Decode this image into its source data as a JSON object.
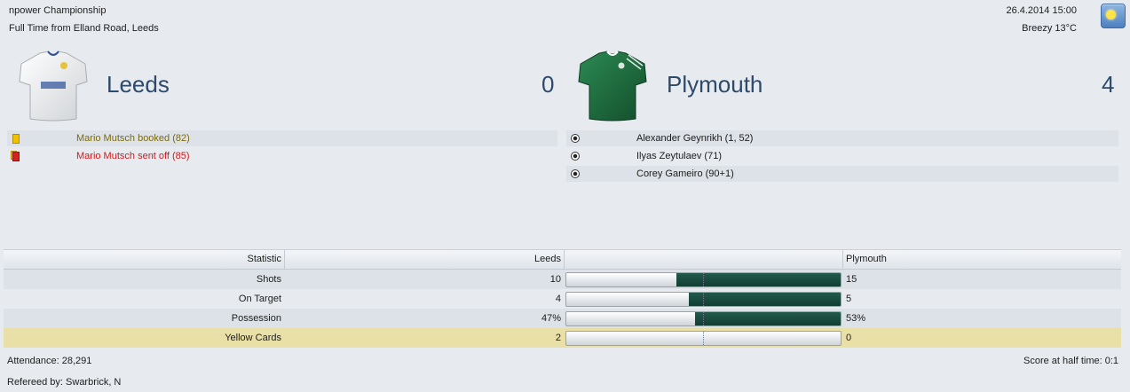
{
  "match": {
    "competition": "npower Championship",
    "result_line": "Full Time from Elland Road, Leeds",
    "datetime": "26.4.2014 15:00",
    "weather": "Breezy 13°C",
    "weather_icon": "sun-icon"
  },
  "home": {
    "name": "Leeds",
    "score": "0",
    "shirt_color": "#f4f4f4",
    "events": [
      {
        "type": "yellow-card",
        "text": "Mario Mutsch booked (82)"
      },
      {
        "type": "red-card",
        "text": "Mario Mutsch sent off (85)"
      }
    ]
  },
  "away": {
    "name": "Plymouth",
    "score": "4",
    "shirt_color": "#1f6b3f",
    "events": [
      {
        "type": "goal",
        "text": "Alexander Geynrikh (1, 52)"
      },
      {
        "type": "goal",
        "text": "Ilyas Zeytulaev (71)"
      },
      {
        "type": "goal",
        "text": "Corey Gameiro (90+1)"
      }
    ]
  },
  "stats": {
    "header": {
      "statistic": "Statistic",
      "home": "Leeds",
      "away": "Plymouth"
    },
    "rows": [
      {
        "label": "Shots",
        "home": "10",
        "away": "15",
        "away_share": 0.6
      },
      {
        "label": "On Target",
        "home": "4",
        "away": "5",
        "away_share": 0.555
      },
      {
        "label": "Possession",
        "home": "47%",
        "away": "53%",
        "away_share": 0.53
      },
      {
        "label": "Yellow Cards",
        "home": "2",
        "away": "0",
        "away_share": 0.0
      }
    ]
  },
  "footer": {
    "attendance": "Attendance: 28,291",
    "referee": "Refereed by: Swarbrick, N",
    "half_time": "Score at half time: 0:1"
  },
  "colors": {
    "bar_fill": "#1a4a3e",
    "highlight_row": "#e9e0a7",
    "team_name": "#2d4a6a"
  }
}
